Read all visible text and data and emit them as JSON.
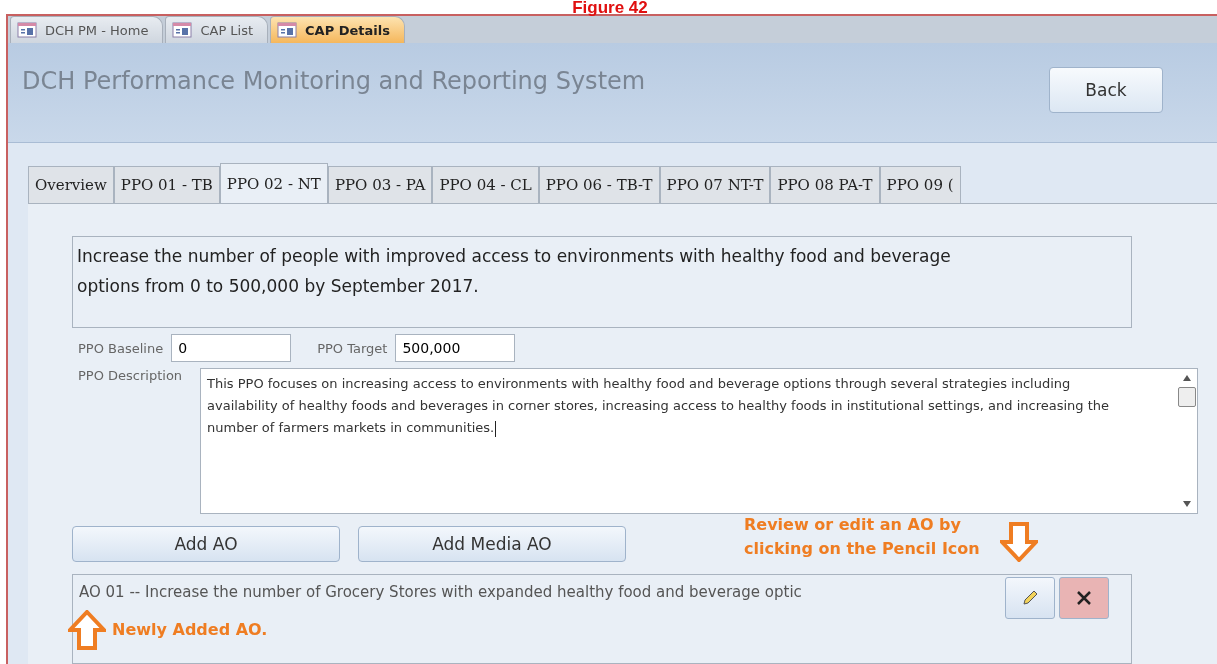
{
  "caption": "Figure 42",
  "document_tabs": [
    {
      "label": "DCH PM - Home",
      "selected": false
    },
    {
      "label": "CAP List",
      "selected": false
    },
    {
      "label": "CAP Details",
      "selected": true
    }
  ],
  "header": {
    "title": "DCH Performance Monitoring and Reporting System",
    "back_button": "Back"
  },
  "tabs": [
    {
      "label": "Overview",
      "selected": false
    },
    {
      "label": "PPO 01 - TB",
      "selected": false
    },
    {
      "label": "PPO 02 - NT",
      "selected": true
    },
    {
      "label": "PPO 03 - PA",
      "selected": false
    },
    {
      "label": "PPO 04 - CL",
      "selected": false
    },
    {
      "label": "PPO 06 - TB-T",
      "selected": false
    },
    {
      "label": "PPO 07 NT-T",
      "selected": false
    },
    {
      "label": "PPO 08 PA-T",
      "selected": false
    },
    {
      "label": "PPO 09 (",
      "selected": false
    }
  ],
  "ppo_statement": "Increase the number of people with improved access to environments with healthy food and beverage options from 0 to 500,000 by September 2017.",
  "baseline": {
    "label": "PPO Baseline",
    "value": "0"
  },
  "target": {
    "label": "PPO Target",
    "value": "500,000"
  },
  "description": {
    "label": "PPO Description",
    "value": "This PPO focuses on increasing access to environments with healthy food and beverage options through several strategies including availability of healthy foods and beverages in corner stores, increasing access to healthy foods in institutional settings, and increasing the number of farmers markets in communities."
  },
  "buttons": [
    "Add AO",
    "Add Media AO"
  ],
  "ao_list": [
    {
      "text": "AO 01 -- Increase the number of Grocery Stores  with expanded healthy food and beverage optic"
    }
  ],
  "annotations": [
    {
      "kind": "down",
      "text": "Review or edit an AO by clicking on the Pencil Icon"
    },
    {
      "kind": "up",
      "text": "Newly Added AO."
    }
  ]
}
